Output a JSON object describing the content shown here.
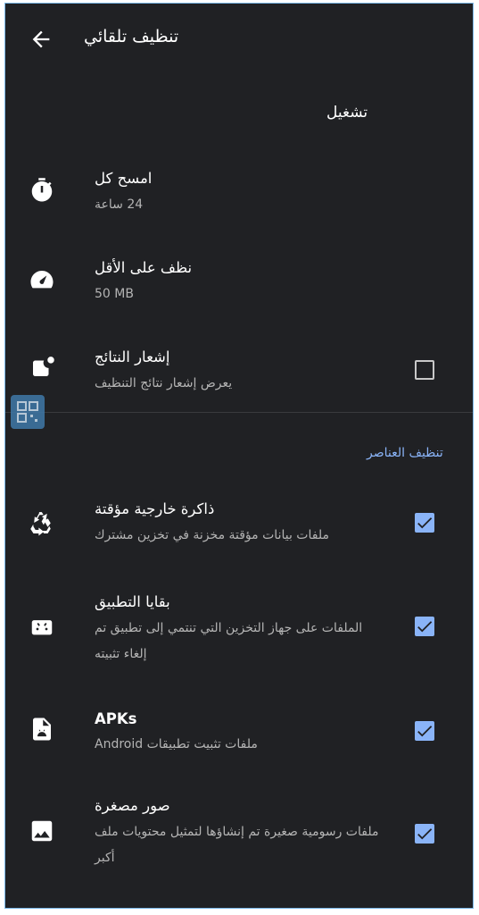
{
  "app_bar": {
    "title": "تنظيف تلقائي",
    "back_icon": "arrow-back-icon"
  },
  "run_section": {
    "header": "تشغيل"
  },
  "run_items": [
    {
      "icon": "stopwatch-icon",
      "title": "امسح كل",
      "subtitle": "24 ساعة"
    },
    {
      "icon": "speedometer-icon",
      "title": "نظف على الأقل",
      "subtitle": "50 MB"
    },
    {
      "icon": "notification-icon",
      "title": "إشعار النتائج",
      "subtitle": "يعرض إشعار نتائج التنظيف",
      "checked": false
    }
  ],
  "items_section": {
    "header": "تنظيف العناصر",
    "accent_color": "#8ab4f8"
  },
  "clean_items": [
    {
      "icon": "recycle-icon",
      "title": "ذاكرة خارجية مؤقتة",
      "subtitle": "ملفات بيانات مؤقتة مخزنة في تخزين مشترك",
      "checked": true
    },
    {
      "icon": "android-icon",
      "title": "بقايا التطبيق",
      "subtitle": "الملفات على جهاز التخزين التي تنتمي إلى تطبيق تم إلغاء تثبيته",
      "checked": true
    },
    {
      "icon": "apk-file-icon",
      "title": "APKs",
      "subtitle": "ملفات تثبيت تطبيقات Android",
      "checked": true
    },
    {
      "icon": "image-icon",
      "title": "صور مصغرة",
      "subtitle": "ملفات رسومية صغيرة تم إنشاؤها لتمثيل محتويات ملف أكبر",
      "checked": true
    }
  ]
}
